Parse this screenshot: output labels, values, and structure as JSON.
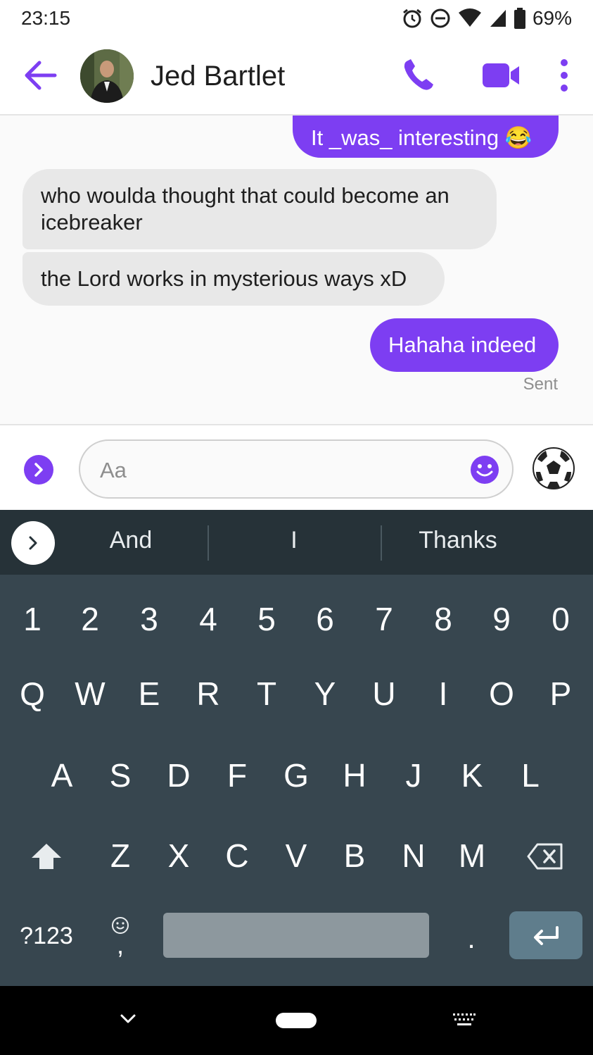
{
  "status_bar": {
    "time": "23:15",
    "battery": "69%",
    "icons": [
      "alarm-icon",
      "do-not-disturb-icon",
      "wifi-icon",
      "signal-icon",
      "battery-icon"
    ]
  },
  "header": {
    "contact_name": "Jed Bartlet",
    "icons": [
      "back-arrow-icon",
      "phone-icon",
      "video-camera-icon",
      "more-vertical-icon"
    ],
    "accent_color": "#7d3ef2"
  },
  "messages": [
    {
      "direction": "out",
      "text": "It _was_ interesting 😂"
    },
    {
      "direction": "in",
      "text": "who woulda thought that could become an icebreaker"
    },
    {
      "direction": "in",
      "text": "the Lord works in mysterious ways xD"
    },
    {
      "direction": "out",
      "text": "Hahaha indeed"
    }
  ],
  "sent_status": "Sent",
  "composer": {
    "placeholder": "Aa",
    "quick_emoji": "⚽"
  },
  "keyboard": {
    "suggestions": [
      "And",
      "I",
      "Thanks"
    ],
    "number_row": [
      "1",
      "2",
      "3",
      "4",
      "5",
      "6",
      "7",
      "8",
      "9",
      "0"
    ],
    "row1": [
      "Q",
      "W",
      "E",
      "R",
      "T",
      "Y",
      "U",
      "I",
      "O",
      "P"
    ],
    "row2": [
      "A",
      "S",
      "D",
      "F",
      "G",
      "H",
      "J",
      "K",
      "L"
    ],
    "row3": [
      "Z",
      "X",
      "C",
      "V",
      "B",
      "N",
      "M"
    ],
    "symbols_key": "?123",
    "comma_key": ",",
    "period_key": "."
  }
}
